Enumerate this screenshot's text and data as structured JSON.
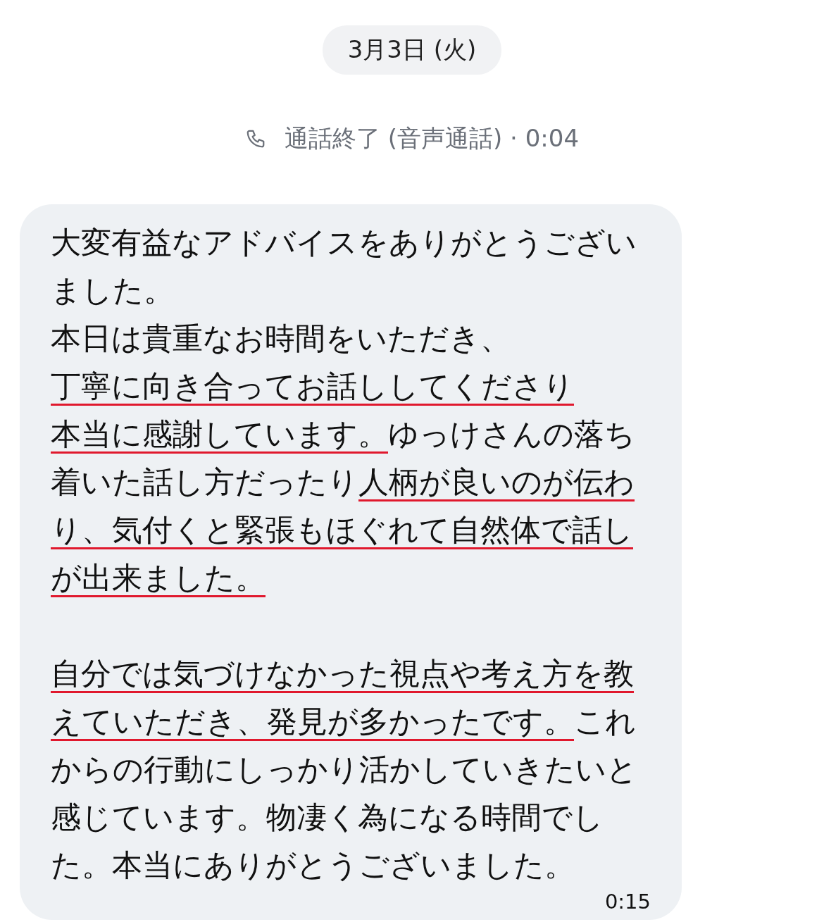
{
  "date_pill": {
    "label": "3月3日 (火)"
  },
  "call_notice": {
    "label": "通話終了 (音声通話) · 0:04"
  },
  "message": {
    "paragraphs": [
      {
        "blocks": [
          {
            "segments": [
              {
                "text": "大変有益なアドバイスをありがとうございました。",
                "underlined": false
              }
            ]
          },
          {
            "segments": [
              {
                "text": "本日は貴重なお時間をいただき、",
                "underlined": false
              }
            ]
          },
          {
            "segments": [
              {
                "text": "丁寧に向き合ってお話ししてくださり",
                "underlined": true
              }
            ]
          },
          {
            "segments": [
              {
                "text": "本当に感謝しています。",
                "underlined": true
              },
              {
                "text": "ゆっけさんの落ち着いた話し方だったり",
                "underlined": false
              },
              {
                "text": "人柄が良いのが伝わり、気付くと緊張もほぐれて自然体で話しが出来ました。",
                "underlined": true
              }
            ]
          }
        ]
      },
      {
        "blocks": [
          {
            "segments": [
              {
                "text": "自分では気づけなかった視点や考え方を教えていただき、発見が多かったです。",
                "underlined": true
              },
              {
                "text": "これからの行動にしっかり活かしていきたいと感じています。物凄く為になる時間でした。本当にありがとうございました。",
                "underlined": false
              }
            ]
          }
        ]
      }
    ],
    "time": "0:15"
  }
}
